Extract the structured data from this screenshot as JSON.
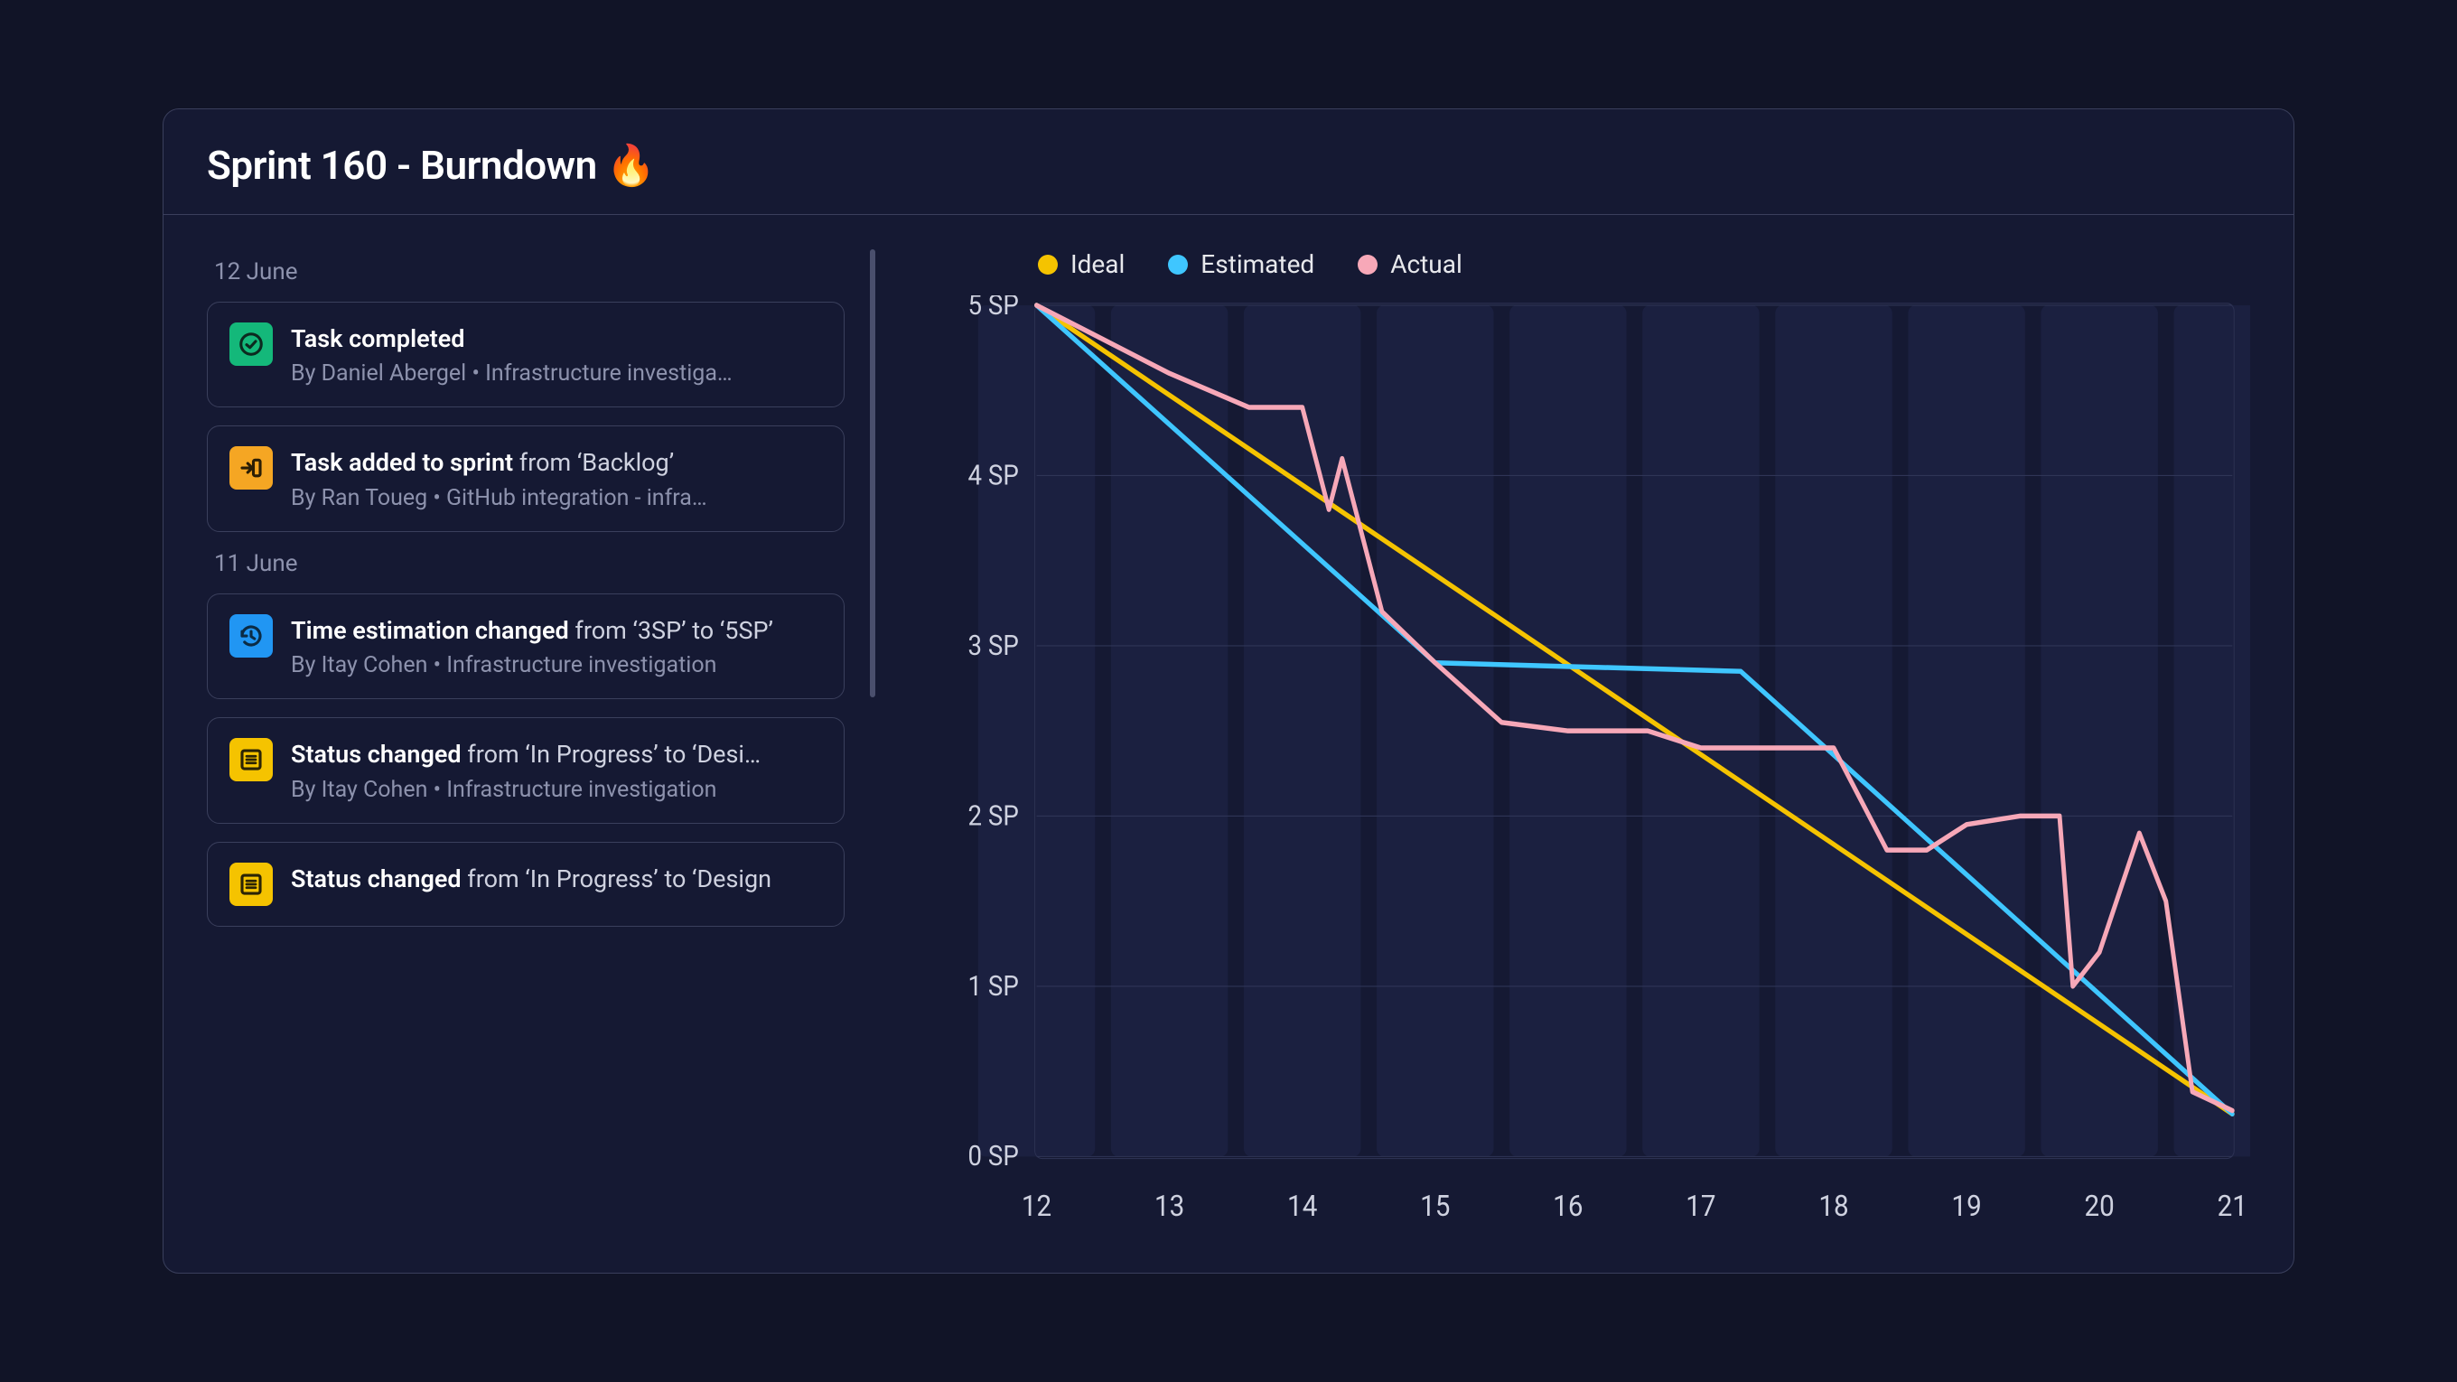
{
  "title": "Sprint 160 - Burndown 🔥",
  "legend": {
    "ideal": "Ideal",
    "estimated": "Estimated",
    "actual": "Actual"
  },
  "colors": {
    "ideal": "#f5c300",
    "estimated": "#3fc6ff",
    "actual": "#f7a8b8"
  },
  "activity": [
    {
      "date_label": "12 June",
      "events": [
        {
          "icon": "check-circle",
          "icon_style": "green",
          "title_strong": "Task completed",
          "title_rest": "",
          "sub_prefix": "By Daniel Abergel",
          "sub_task": "Infrastructure investiga…"
        },
        {
          "icon": "arrow-in",
          "icon_style": "orange",
          "title_strong": "Task added to sprint",
          "title_rest": " from ‘Backlog’",
          "sub_prefix": "By Ran Toueg",
          "sub_task": "GitHub integration - infra…"
        }
      ]
    },
    {
      "date_label": "11 June",
      "events": [
        {
          "icon": "history",
          "icon_style": "blue",
          "title_strong": "Time estimation changed",
          "title_rest": " from ‘3SP’ to ‘5SP’",
          "sub_prefix": "By Itay Cohen",
          "sub_task": "Infrastructure investigation"
        },
        {
          "icon": "list",
          "icon_style": "yellow",
          "title_strong": "Status changed",
          "title_rest": " from ‘In Progress’ to ‘Desi…",
          "sub_prefix": "By Itay Cohen",
          "sub_task": "Infrastructure investigation"
        },
        {
          "icon": "list",
          "icon_style": "yellow",
          "title_strong": "Status changed",
          "title_rest": " from ‘In Progress’ to ‘Design",
          "sub_prefix": "",
          "sub_task": ""
        }
      ]
    }
  ],
  "chart_data": {
    "type": "line",
    "title": "Sprint 160 - Burndown",
    "xlabel": "",
    "ylabel": "",
    "x": [
      12,
      13,
      14,
      15,
      16,
      17,
      18,
      19,
      20,
      21
    ],
    "y_ticks": [
      "5 SP",
      "4 SP",
      "3 SP",
      "2 SP",
      "1 SP",
      "0 SP"
    ],
    "ylim": [
      0,
      5
    ],
    "series": [
      {
        "name": "Ideal",
        "color": "#f5c300",
        "x": [
          12,
          21
        ],
        "y": [
          5,
          0.25
        ]
      },
      {
        "name": "Estimated",
        "color": "#3fc6ff",
        "x": [
          12,
          15,
          17.3,
          21
        ],
        "y": [
          5,
          2.9,
          2.85,
          0.25
        ]
      },
      {
        "name": "Actual",
        "color": "#f7a8b8",
        "x": [
          12,
          12.5,
          13,
          13.6,
          14,
          14.2,
          14.3,
          14.6,
          15,
          15.5,
          16,
          16.6,
          17,
          17.4,
          18,
          18.4,
          18.7,
          19,
          19.4,
          19.7,
          19.8,
          20,
          20.3,
          20.5,
          20.7,
          21
        ],
        "y": [
          5,
          4.8,
          4.6,
          4.4,
          4.4,
          3.8,
          4.1,
          3.2,
          2.9,
          2.55,
          2.5,
          2.5,
          2.4,
          2.4,
          2.4,
          1.8,
          1.8,
          1.95,
          2.0,
          2.0,
          1.0,
          1.2,
          1.9,
          1.5,
          0.38,
          0.27
        ]
      }
    ]
  }
}
